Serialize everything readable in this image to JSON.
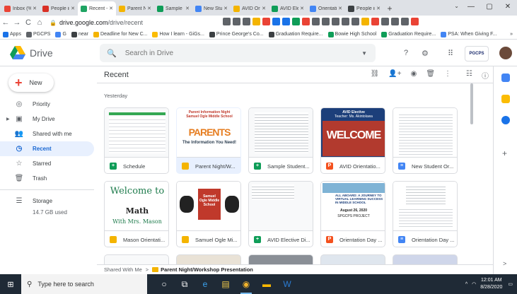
{
  "browser": {
    "tabs": [
      {
        "label": "Inbox (%",
        "color": "#ea4335",
        "active": false
      },
      {
        "label": "People in",
        "color": "#d93025",
        "active": false
      },
      {
        "label": "Recent -",
        "color": "#1fa463",
        "active": true
      },
      {
        "label": "Parent Ni",
        "color": "#f4b400",
        "active": false
      },
      {
        "label": "Sample St",
        "color": "#0f9d58",
        "active": false
      },
      {
        "label": "New Stud",
        "color": "#4285f4",
        "active": false
      },
      {
        "label": "AVID Ori",
        "color": "#f4b400",
        "active": false
      },
      {
        "label": "AVID Ele",
        "color": "#0f9d58",
        "active": false
      },
      {
        "label": "Orientati",
        "color": "#4285f4",
        "active": false
      },
      {
        "label": "People in",
        "color": "#3c4043",
        "active": false
      }
    ],
    "new_tab": "+",
    "window_controls": [
      "—",
      "▢",
      "✕"
    ],
    "nav": {
      "back": "←",
      "forward": "→",
      "reload": "C",
      "home": "⌂"
    },
    "url_host": "drive.google.com",
    "url_path": "/drive/recent",
    "extension_colors": [
      "#5f6368",
      "#5f6368",
      "#5f6368",
      "#f4b400",
      "#ea4335",
      "#1a73e8",
      "#1a73e8",
      "#0f9d58",
      "#ea4335",
      "#5f6368",
      "#5f6368",
      "#5f6368",
      "#5f6368",
      "#5f6368",
      "#f4b400",
      "#ea4335",
      "#5f6368",
      "#5f6368",
      "#5f6368",
      "#ea4335"
    ]
  },
  "bookmarks": {
    "items": [
      {
        "label": "Apps",
        "color": "#1a73e8"
      },
      {
        "label": "PGCPS",
        "color": "#5f6368"
      },
      {
        "label": "G",
        "color": "#4285f4"
      },
      {
        "label": "near",
        "color": "#3c4043"
      },
      {
        "label": "Deadline for New C...",
        "color": "#f4b400"
      },
      {
        "label": "How I learn - GiGs...",
        "color": "#fbbc04"
      },
      {
        "label": "Prince George's Co...",
        "color": "#3c4043"
      },
      {
        "label": "Graduation Require...",
        "color": "#3c4043"
      },
      {
        "label": "Bowie High School",
        "color": "#0f9d58"
      },
      {
        "label": "Graduation Require...",
        "color": "#0f9d58"
      },
      {
        "label": "PSA: When Giving F...",
        "color": "#4285f4"
      }
    ],
    "more": "»"
  },
  "drive": {
    "title": "Drive",
    "search_placeholder": "Search in Drive",
    "org_logo_text": "PGCPS"
  },
  "sidebar": {
    "new_label": "New",
    "items": [
      {
        "label": "Priority",
        "icon": "◎"
      },
      {
        "label": "My Drive",
        "icon": "▣"
      },
      {
        "label": "Shared with me",
        "icon": "👥"
      },
      {
        "label": "Recent",
        "icon": "◷"
      },
      {
        "label": "Starred",
        "icon": "☆"
      },
      {
        "label": "Trash",
        "icon": "🗑"
      }
    ],
    "storage_label": "Storage",
    "storage_used": "14.7 GB used"
  },
  "main": {
    "title": "Recent",
    "section": "Yesterday",
    "files": [
      {
        "name": "Schedule",
        "type": "sheets",
        "badge": "+"
      },
      {
        "name": "Parent Night/W...",
        "type": "folder",
        "badge": ""
      },
      {
        "name": "Sample Student...",
        "type": "sheets",
        "badge": "+"
      },
      {
        "name": "AVID Orientatio...",
        "type": "slides",
        "badge": "P"
      },
      {
        "name": "New Student Or...",
        "type": "docs",
        "badge": "≡"
      },
      {
        "name": "Mason Orientati...",
        "type": "folder",
        "badge": ""
      },
      {
        "name": "Samuel Ogle Mi...",
        "type": "folder",
        "badge": ""
      },
      {
        "name": "AVID Elective Di...",
        "type": "sheets",
        "badge": "+"
      },
      {
        "name": "Orientation Day ...",
        "type": "slides",
        "badge": "P"
      },
      {
        "name": "Orientation Day ...",
        "type": "docs",
        "badge": "≡"
      }
    ],
    "thumbs": {
      "parents_banner_top": "Parent Information Night",
      "parents_banner_mid": "Samuel Ogle Middle School",
      "parents_word": "PARENTS",
      "parents_tag": "The Information You Need!",
      "avid_title": "AVID Elective",
      "avid_teacher": "Teacher: Ms. Akintoluwa",
      "avid_word": "WELCOME",
      "mason_welcome": "Welcome to",
      "mason_math": "Math",
      "mason_teacher": "With Mrs. Mason",
      "samuel_title": "Samuel Ogle Middle School",
      "orient_title": "ALL ABOARD: A JOURNEY TO VIRTUAL LEARNING SUCCESS IN MIDDLE SCHOOL",
      "orient_date": "August 26, 2020",
      "orient_org": "SPGCPS PROJECT"
    }
  },
  "breadcrumb": {
    "root": "Shared With Me",
    "sep": ">",
    "current": "Parent Night/Workshop Presentation"
  },
  "taskbar": {
    "search_placeholder": "Type here to search",
    "time": "12:01 AM",
    "date": "8/28/2020"
  },
  "colors": {
    "sheets": "#0f9d58",
    "docs": "#4285f4",
    "slides": "#f4b400",
    "folder": "#f4b400",
    "selected_bg": "#e8f0fe",
    "accent": "#1967d2"
  }
}
